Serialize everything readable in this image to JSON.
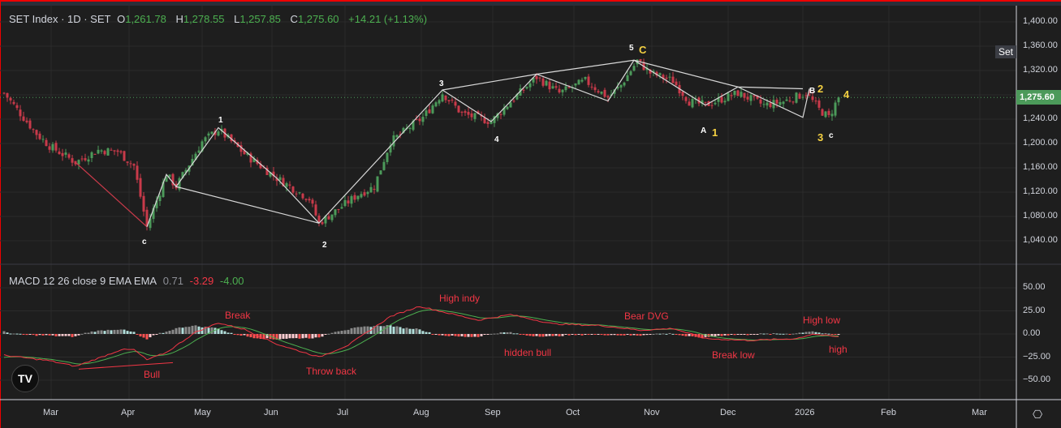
{
  "header": {
    "symbol": "SET Index · 1D · SET",
    "o_label": "O",
    "o": "1,261.78",
    "h_label": "H",
    "h": "1,278.55",
    "l_label": "L",
    "l": "1,257.85",
    "c_label": "C",
    "c": "1,275.60",
    "change": "+14.21 (+1.13%)"
  },
  "price_tag": "1,275.60",
  "set_tag": "Set",
  "macd_legend": {
    "label": "MACD 12 26 close 9 EMA EMA",
    "hist": "0.71",
    "macd": "-3.29",
    "signal": "-4.00"
  },
  "logo": "TV",
  "settings_icon": "⎔",
  "colors": {
    "up": "#4c9a5a",
    "down": "#c93a4a",
    "macd": "#f23645",
    "signal": "#4caf50",
    "wave_line": "#d8d8d8"
  },
  "chart_data": [
    {
      "type": "candlestick",
      "title": "SET Index · 1D · SET",
      "ylim": [
        1010,
        1420
      ],
      "yticks": [
        "1,400.00",
        "1,360.00",
        "1,320.00",
        "1,280.00",
        "1,240.00",
        "1,200.00",
        "1,160.00",
        "1,120.00",
        "1,080.00",
        "1,040.00"
      ],
      "ytick_values": [
        1400,
        1360,
        1320,
        1280,
        1240,
        1200,
        1160,
        1120,
        1080,
        1040
      ],
      "ytick_labels_shown": [
        "1,400.00",
        "1,360.00",
        "1,320.00",
        "1,240.00",
        "1,200.00",
        "1,160.00",
        "1,120.00",
        "1,080.00",
        "1,040.00"
      ],
      "xticks": [
        "Mar",
        "Apr",
        "May",
        "Jun",
        "Jul",
        "Aug",
        "Sep",
        "Oct",
        "Nov",
        "Dec",
        "2026",
        "Feb",
        "Mar"
      ],
      "xtick_days": [
        14.5,
        38.5,
        61,
        82.5,
        105,
        128.5,
        150.5,
        175.5,
        199.5,
        223,
        246,
        272.5,
        300.5
      ],
      "last_close": 1275.6,
      "close_path": [
        [
          0,
          1283
        ],
        [
          4,
          1256
        ],
        [
          10,
          1216
        ],
        [
          14,
          1196
        ],
        [
          22,
          1169
        ],
        [
          29,
          1189
        ],
        [
          35,
          1187
        ],
        [
          40,
          1163
        ],
        [
          44,
          1063
        ],
        [
          50,
          1149
        ],
        [
          53,
          1129
        ],
        [
          61,
          1203
        ],
        [
          66,
          1223
        ],
        [
          74,
          1183
        ],
        [
          84,
          1143
        ],
        [
          94,
          1109
        ],
        [
          97,
          1069
        ],
        [
          109,
          1116
        ],
        [
          114,
          1129
        ],
        [
          119,
          1203
        ],
        [
          129,
          1243
        ],
        [
          135,
          1283
        ],
        [
          141,
          1249
        ],
        [
          150,
          1236
        ],
        [
          156,
          1269
        ],
        [
          164,
          1309
        ],
        [
          171,
          1283
        ],
        [
          179,
          1303
        ],
        [
          186,
          1276
        ],
        [
          190,
          1296
        ],
        [
          195,
          1336
        ],
        [
          199,
          1316
        ],
        [
          206,
          1303
        ],
        [
          211,
          1269
        ],
        [
          216,
          1263
        ],
        [
          226,
          1283
        ],
        [
          234,
          1263
        ],
        [
          240,
          1269
        ],
        [
          247,
          1283
        ],
        [
          251,
          1256
        ],
        [
          254,
          1243
        ],
        [
          257,
          1276
        ]
      ],
      "wave_lines": [
        [
          [
            22,
            1169
          ],
          [
            44,
            1063
          ]
        ],
        [
          [
            44,
            1063
          ],
          [
            50,
            1149
          ],
          [
            53,
            1129
          ],
          [
            66,
            1226
          ],
          [
            84,
            1143
          ],
          [
            97,
            1069
          ],
          [
            135,
            1288
          ],
          [
            150,
            1236
          ],
          [
            164,
            1314
          ],
          [
            186,
            1270
          ],
          [
            194,
            1337
          ],
          [
            216,
            1263
          ],
          [
            226,
            1293
          ],
          [
            246,
            1243
          ],
          [
            248,
            1290
          ]
        ],
        [
          [
            53,
            1129
          ],
          [
            97,
            1069
          ]
        ],
        [
          [
            135,
            1288
          ],
          [
            164,
            1314
          ],
          [
            194,
            1337
          ],
          [
            226,
            1293
          ],
          [
            246,
            1290
          ]
        ]
      ],
      "wave_labels": [
        {
          "t": "c",
          "d": 42.5,
          "p": 1045,
          "y": false
        },
        {
          "t": "1",
          "d": 66,
          "p": 1245,
          "y": false
        },
        {
          "t": "2",
          "d": 98,
          "p": 1040,
          "y": false
        },
        {
          "t": "3",
          "d": 134,
          "p": 1306,
          "y": false
        },
        {
          "t": "4",
          "d": 151,
          "p": 1214,
          "y": false
        },
        {
          "t": "5",
          "d": 192.5,
          "p": 1364,
          "y": false
        },
        {
          "t": "C",
          "d": 195.5,
          "p": 1364,
          "y": true
        },
        {
          "t": "A",
          "d": 214.5,
          "p": 1228,
          "y": false
        },
        {
          "t": "1",
          "d": 218,
          "p": 1228,
          "y": true
        },
        {
          "t": "B",
          "d": 248,
          "p": 1294,
          "y": false
        },
        {
          "t": "2",
          "d": 250.5,
          "p": 1300,
          "y": true
        },
        {
          "t": "3",
          "d": 250.5,
          "p": 1220,
          "y": true
        },
        {
          "t": "c",
          "d": 254,
          "p": 1220,
          "y": false
        },
        {
          "t": "4",
          "d": 258.5,
          "p": 1291,
          "y": true
        }
      ]
    },
    {
      "type": "macd",
      "ylim": [
        -72,
        68
      ],
      "yticks": [
        "50.00",
        "25.00",
        "0.00",
        "−25.00",
        "−50.00"
      ],
      "ytick_values": [
        50,
        25,
        0,
        -25,
        -50
      ],
      "macd_path": [
        [
          0,
          -23
        ],
        [
          14,
          -29
        ],
        [
          22,
          -35
        ],
        [
          30,
          -25
        ],
        [
          36,
          -17
        ],
        [
          40,
          -17
        ],
        [
          44,
          -28
        ],
        [
          50,
          -20
        ],
        [
          59,
          2
        ],
        [
          66,
          12
        ],
        [
          74,
          5
        ],
        [
          84,
          -11
        ],
        [
          97,
          -25
        ],
        [
          106,
          -12
        ],
        [
          119,
          19
        ],
        [
          128,
          30
        ],
        [
          135,
          24
        ],
        [
          146,
          15
        ],
        [
          156,
          21
        ],
        [
          169,
          11
        ],
        [
          184,
          9
        ],
        [
          196,
          4
        ],
        [
          206,
          6
        ],
        [
          216,
          -5
        ],
        [
          229,
          -7
        ],
        [
          244,
          -5
        ],
        [
          249,
          0
        ],
        [
          257,
          -3.3
        ]
      ],
      "annotations": [
        {
          "t": "Bull",
          "d": 46,
          "v": -44
        },
        {
          "t": "Break",
          "d": 71,
          "v": 20
        },
        {
          "t": "Throw back",
          "d": 96,
          "v": -40
        },
        {
          "t": "High indy",
          "d": 137,
          "v": 39
        },
        {
          "t": "hidden bull",
          "d": 157,
          "v": -20
        },
        {
          "t": "Bear DVG",
          "d": 194,
          "v": 19
        },
        {
          "t": "Break low",
          "d": 221,
          "v": -23
        },
        {
          "t": "High low",
          "d": 249,
          "v": 15
        },
        {
          "t": "high",
          "d": 257,
          "v": -17
        }
      ]
    }
  ]
}
